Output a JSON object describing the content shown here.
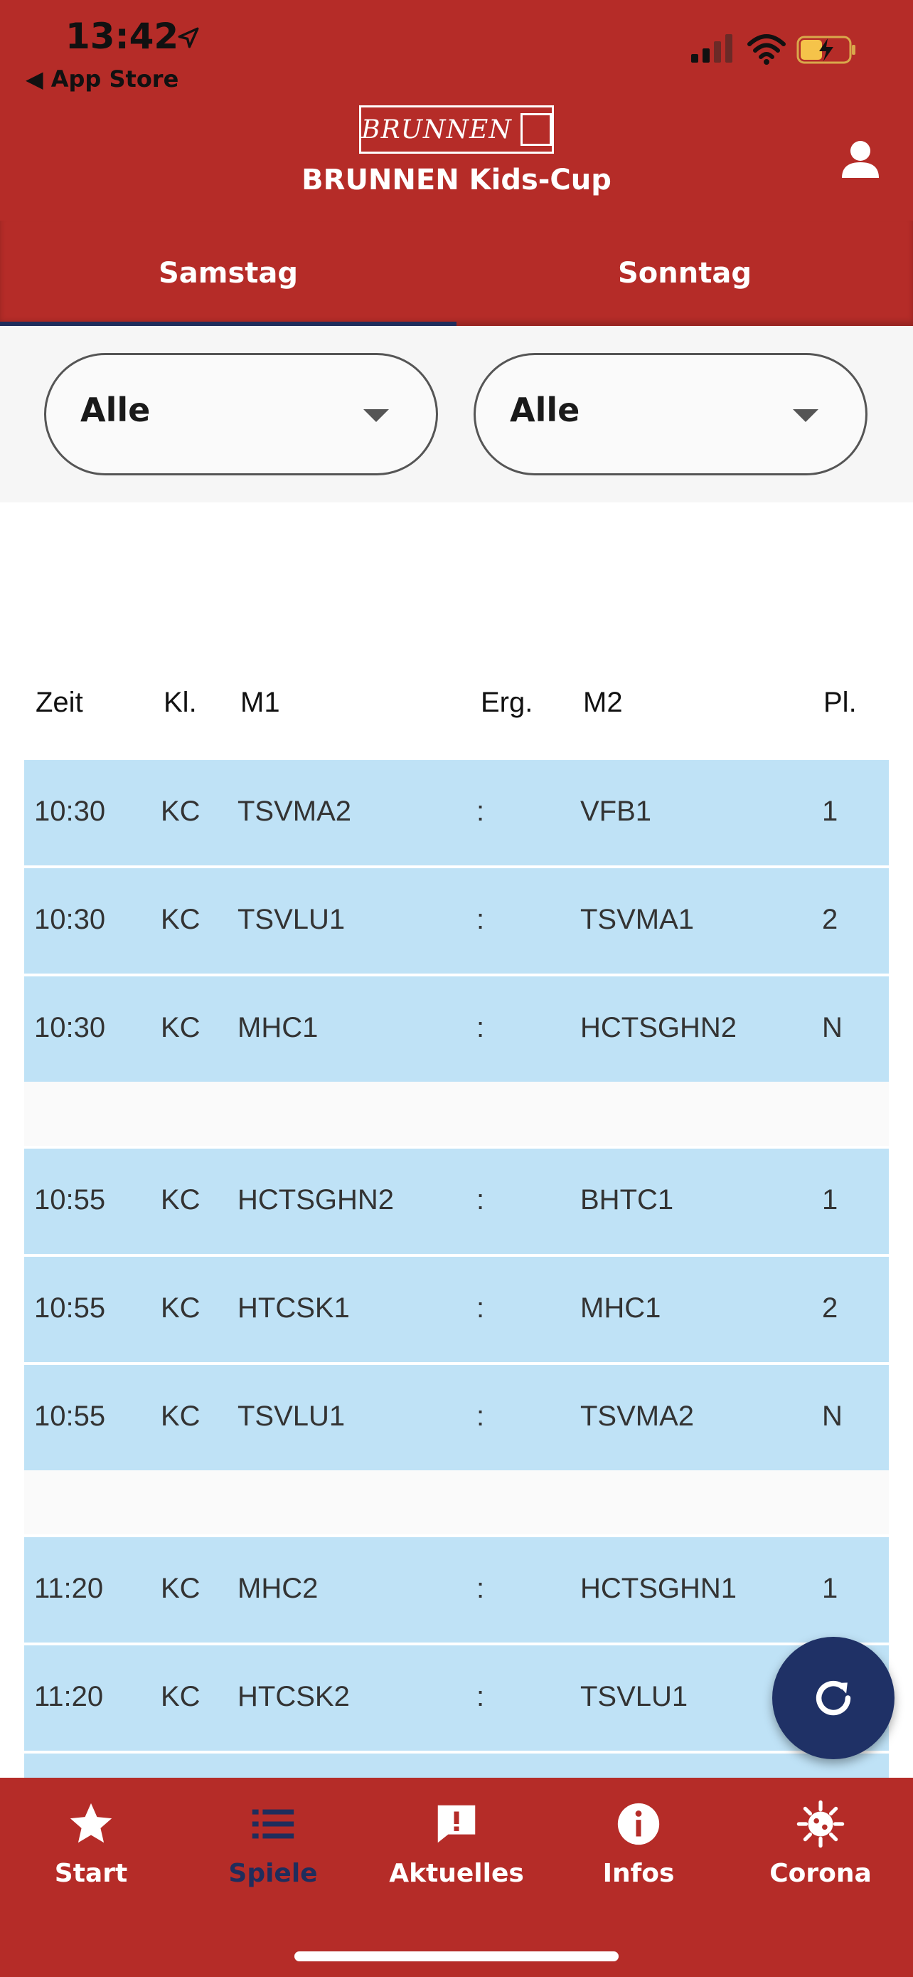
{
  "status_bar": {
    "time": "13:42",
    "back_label": "App Store"
  },
  "header": {
    "logo_text": "BRUNNEN",
    "title": "BRUNNEN Kids-Cup",
    "profile_icon": "person-icon"
  },
  "tabs": [
    {
      "label": "Samstag",
      "active": true
    },
    {
      "label": "Sonntag",
      "active": false
    }
  ],
  "filters": [
    {
      "value": "Alle"
    },
    {
      "value": "Alle"
    }
  ],
  "table": {
    "headers": {
      "time": "Zeit",
      "class": "Kl.",
      "m1": "M1",
      "result": "Erg.",
      "m2": "M2",
      "place": "Pl."
    },
    "rows": [
      {
        "time": "10:30",
        "class": "KC",
        "m1": "TSVMA2",
        "sep": ":",
        "m2": "VFB1",
        "place": "1"
      },
      {
        "time": "10:30",
        "class": "KC",
        "m1": "TSVLU1",
        "sep": ":",
        "m2": "TSVMA1",
        "place": "2"
      },
      {
        "time": "10:30",
        "class": "KC",
        "m1": "MHC1",
        "sep": ":",
        "m2": "HCTSGHN2",
        "place": "N"
      },
      {
        "time": "10:55",
        "class": "KC",
        "m1": "HCTSGHN2",
        "sep": ":",
        "m2": "BHTC1",
        "place": "1"
      },
      {
        "time": "10:55",
        "class": "KC",
        "m1": "HTCSK1",
        "sep": ":",
        "m2": "MHC1",
        "place": "2"
      },
      {
        "time": "10:55",
        "class": "KC",
        "m1": "TSVLU1",
        "sep": ":",
        "m2": "TSVMA2",
        "place": "N"
      },
      {
        "time": "11:20",
        "class": "KC",
        "m1": "MHC2",
        "sep": ":",
        "m2": "HCTSGHN1",
        "place": "1"
      },
      {
        "time": "11:20",
        "class": "KC",
        "m1": "HTCSK2",
        "sep": ":",
        "m2": "TSVLU1",
        "place": ""
      }
    ]
  },
  "bottom_nav": [
    {
      "label": "Start",
      "icon": "star-icon",
      "active": false
    },
    {
      "label": "Spiele",
      "icon": "list-icon",
      "active": true
    },
    {
      "label": "Aktuelles",
      "icon": "exclamation-bubble-icon",
      "active": false
    },
    {
      "label": "Infos",
      "icon": "info-icon",
      "active": false
    },
    {
      "label": "Corona",
      "icon": "virus-icon",
      "active": false
    }
  ],
  "colors": {
    "brand_red": "#b52c28",
    "navy": "#1f2d5c",
    "row_blue": "#bfe2f6"
  }
}
